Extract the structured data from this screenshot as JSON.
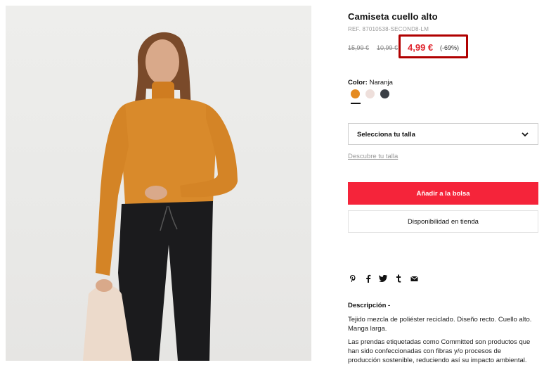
{
  "product": {
    "title": "Camiseta cuello alto",
    "ref": "REF. 87010538-SECOND8-LM",
    "old_price_1": "15,99 €",
    "old_price_2": "10,99 €",
    "price": "4,99 €",
    "discount": "(-69%)"
  },
  "color": {
    "label": "Color:",
    "value": "Naranja",
    "swatches": [
      {
        "name": "Naranja",
        "hex": "#e58a1f",
        "selected": true
      },
      {
        "name": "Crudo",
        "hex": "#eedfdb",
        "selected": false
      },
      {
        "name": "Gris oscuro",
        "hex": "#3b3f46",
        "selected": false
      }
    ]
  },
  "size": {
    "select_label": "Selecciona tu talla",
    "guide_link": "Descubre tu talla"
  },
  "actions": {
    "add_to_bag": "Añadir a la bolsa",
    "store_availability": "Disponibilidad en tienda"
  },
  "share_icons": [
    "pinterest-icon",
    "facebook-icon",
    "twitter-icon",
    "tumblr-icon",
    "email-icon"
  ],
  "description": {
    "title": "Descripción -",
    "p1": "Tejido mezcla de poliéster reciclado. Diseño recto. Cuello alto. Manga larga.",
    "p2": "Las prendas etiquetadas como Committed son productos que han sido confeccionadas con fibras y/o procesos de producción sostenible, reduciendo así su impacto ambiental."
  },
  "colors": {
    "accent_red": "#f5243a",
    "price_red": "#e0262e",
    "highlight_box": "#b00000",
    "sweater_orange": "#d98a2b"
  }
}
